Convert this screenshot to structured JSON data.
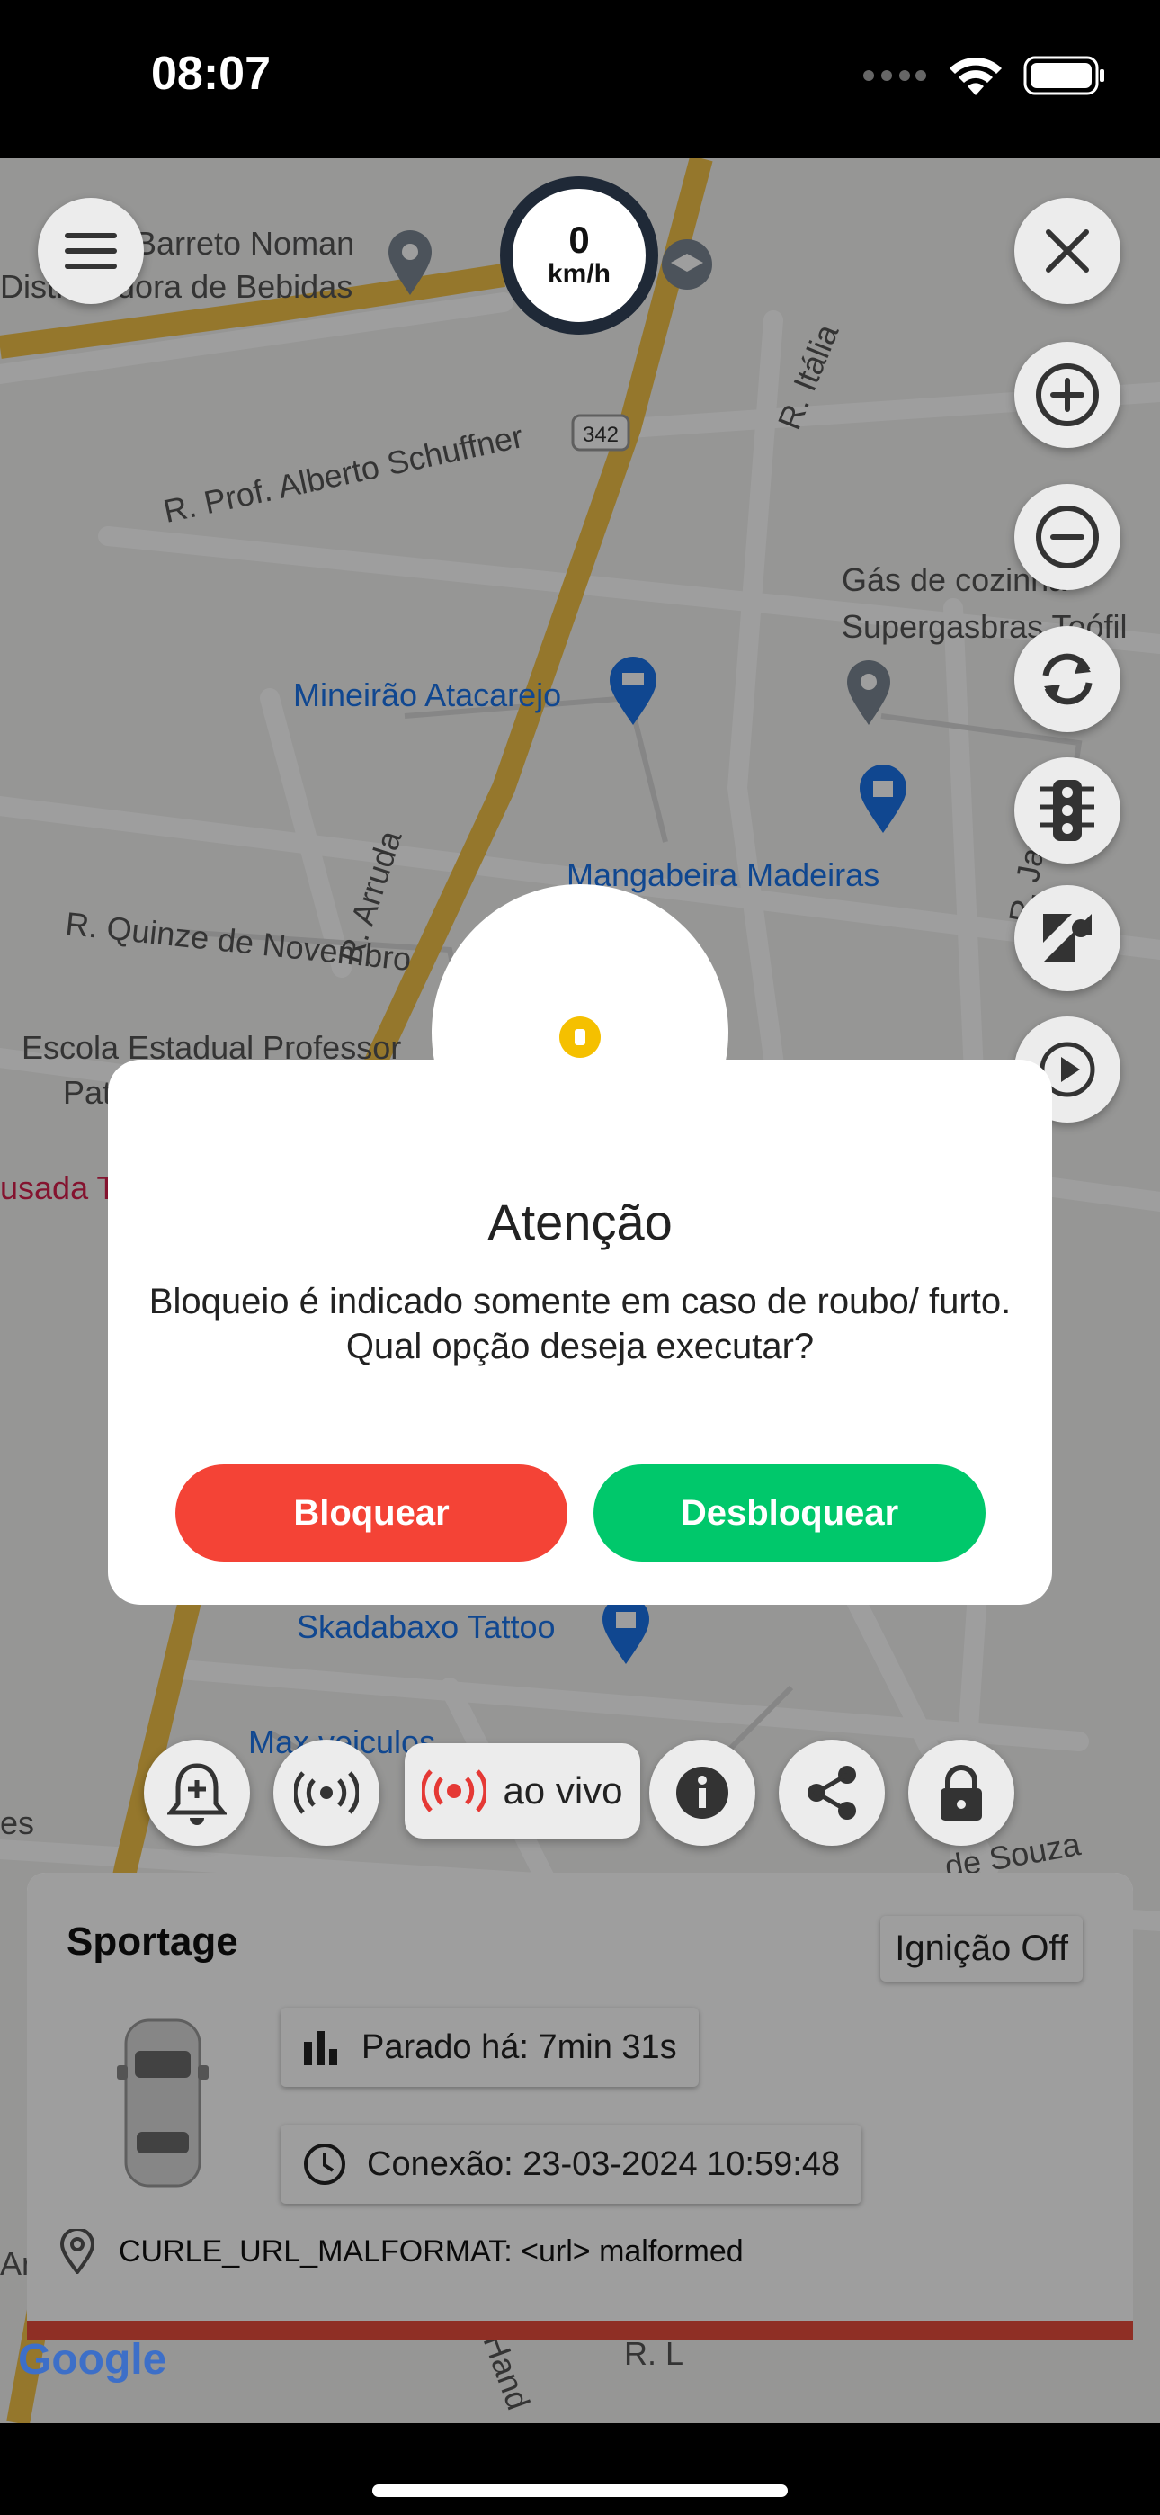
{
  "status_bar": {
    "time": "08:07"
  },
  "map": {
    "speed_value": "0",
    "speed_unit": "km/h",
    "road_shield": "342",
    "places": [
      "Barreto Noman",
      "Distribuidora de Bebidas",
      "R. Prof. Alberto Schuffner",
      "R. Itália",
      "Gás de cozinha",
      "Supergasbras Teófil",
      "Mineirão Atacarejo",
      "R. Arruda",
      "R. Jamaica",
      "Mangabeira Madeiras",
      "R. Quinze de Novembro",
      "Escola Estadual Professor",
      "Pat",
      "usada T",
      "Skadabaxo Tattoo",
      "Max veiculos",
      "de Souza",
      "R. L",
      "Hand",
      "es",
      "Ar"
    ],
    "google_logo": "Google"
  },
  "toolbar": {
    "live_label": "ao vivo"
  },
  "vehicle_card": {
    "name": "Sportage",
    "ignition": "Ignição Off",
    "parked": "Parado há: 7min 31s",
    "connection": "Conexão: 23-03-2024 10:59:48",
    "address": "CURLE_URL_MALFORMAT: <url> malformed"
  },
  "dialog": {
    "title": "Atenção",
    "message": "Bloqueio é indicado somente em caso de roubo/ furto. Qual opção deseja executar?",
    "block_label": "Bloquear",
    "unblock_label": "Desbloquear"
  },
  "colors": {
    "block": "#f44336",
    "unblock": "#00c86b",
    "warning": "#f5c000",
    "card_accent": "#e74c3c"
  }
}
